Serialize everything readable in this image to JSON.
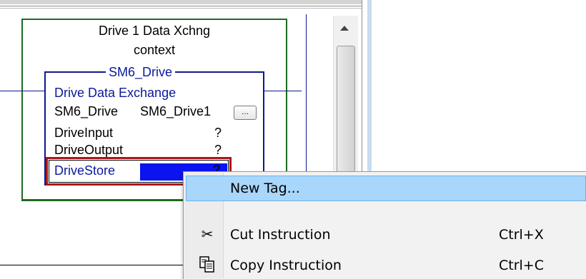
{
  "block": {
    "title_line1": "Drive 1 Data Xchng",
    "title_line2": "context",
    "instruction_name": "SM6_Drive",
    "instruction_type": "Drive Data Exchange",
    "params": [
      {
        "name": "SM6_Drive",
        "value": "SM6_Drive1"
      },
      {
        "name": "DriveInput",
        "value": "?"
      },
      {
        "name": "DriveOutput",
        "value": "?"
      },
      {
        "name": "DriveStore",
        "value": "?"
      }
    ],
    "browse_label": "..."
  },
  "context_menu": {
    "items": [
      {
        "label": "New Tag...",
        "shortcut": "",
        "icon": ""
      },
      {
        "label": "Cut Instruction",
        "shortcut": "Ctrl+X",
        "icon": "scissors-icon"
      },
      {
        "label": "Copy Instruction",
        "shortcut": "Ctrl+C",
        "icon": "copy-icon"
      }
    ]
  },
  "colors": {
    "routine_border": "#1c6b22",
    "block_border": "#0c1a8c",
    "block_text": "#0a1a9a",
    "highlight_border": "#a8161c",
    "selected_value_bg": "#0a13f0",
    "menu_highlight": "#a9d6fb"
  }
}
